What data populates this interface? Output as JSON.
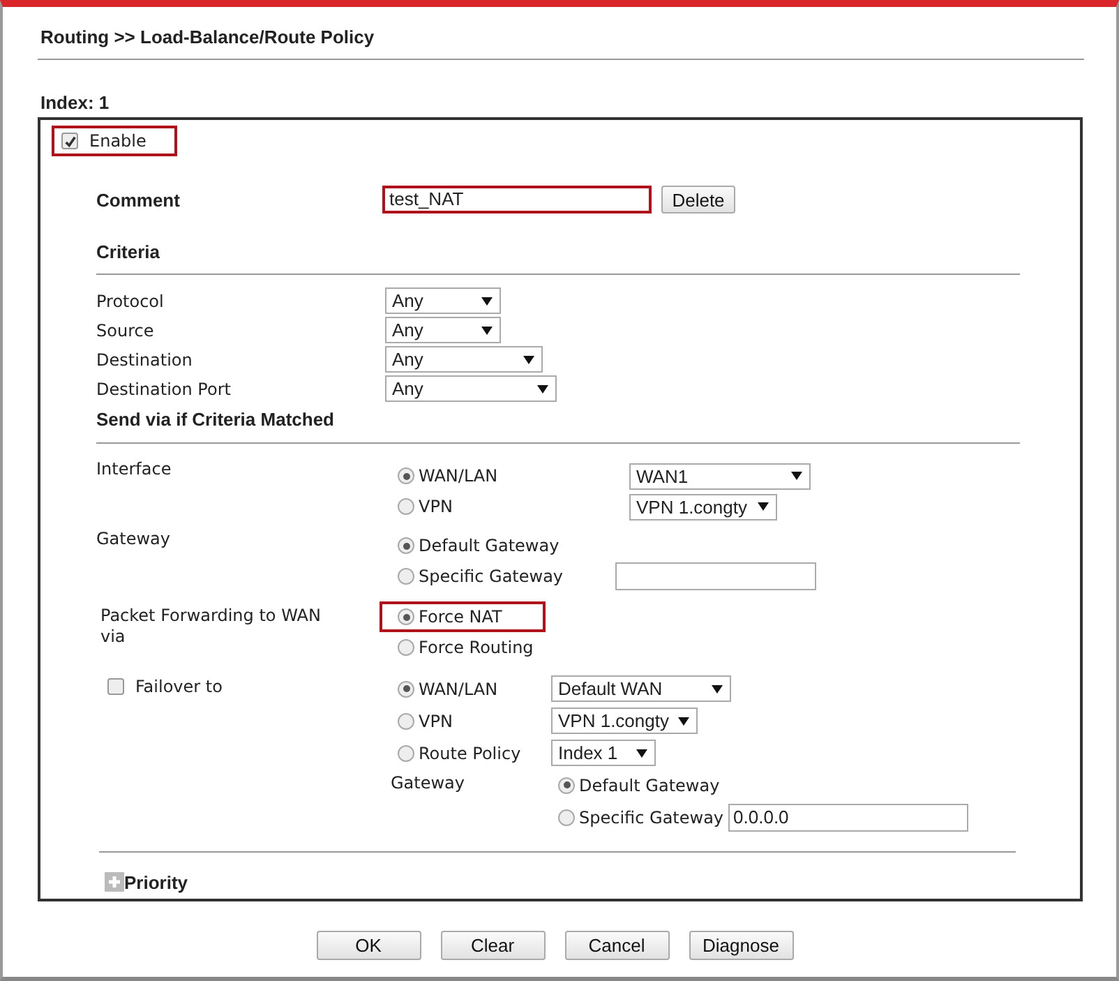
{
  "breadcrumb": "Routing >> Load-Balance/Route Policy",
  "index_label": "Index: 1",
  "enable": {
    "label": "Enable",
    "checked": true,
    "highlighted": true
  },
  "comment": {
    "label": "Comment",
    "value": "test_NAT",
    "highlighted": true,
    "button": "Delete"
  },
  "criteria": {
    "title": "Criteria",
    "fields": [
      {
        "label": "Protocol",
        "value": "Any"
      },
      {
        "label": "Source",
        "value": "Any"
      },
      {
        "label": "Destination",
        "value": "Any"
      },
      {
        "label": "Destination Port",
        "value": "Any"
      }
    ]
  },
  "send_via": {
    "title": "Send via if Criteria Matched",
    "interface": {
      "label": "Interface",
      "options": [
        {
          "label": "WAN/LAN",
          "selected": true,
          "kind": "select",
          "value": "WAN1"
        },
        {
          "label": "VPN",
          "selected": false,
          "kind": "select",
          "value": "VPN 1.congty"
        }
      ]
    },
    "gateway": {
      "label": "Gateway",
      "options": [
        {
          "label": "Default Gateway",
          "selected": true,
          "kind": "plain"
        },
        {
          "label": "Specific Gateway",
          "selected": false,
          "kind": "input"
        }
      ]
    },
    "packet_forwarding": {
      "label": "Packet Forwarding to WAN via",
      "options": [
        {
          "label": "Force NAT",
          "selected": true,
          "highlighted": true
        },
        {
          "label": "Force Routing",
          "selected": false,
          "highlighted": false
        }
      ]
    },
    "failover": {
      "label": "Failover to",
      "checked": false,
      "options": [
        {
          "label": "WAN/LAN",
          "selected": true,
          "kind": "select",
          "value": "Default WAN"
        },
        {
          "label": "VPN",
          "selected": false,
          "kind": "select",
          "value": "VPN 1.congty"
        },
        {
          "label": "Route Policy",
          "selected": false,
          "kind": "select",
          "value": "Index 1"
        }
      ],
      "gateway": {
        "label": "Gateway",
        "options": [
          {
            "label": "Default Gateway",
            "selected": true,
            "kind": "plain"
          },
          {
            "label": "Specific Gateway",
            "selected": false,
            "kind": "input",
            "value": "0.0.0.0"
          }
        ]
      }
    }
  },
  "priority": {
    "label": "Priority",
    "expanded": false
  },
  "buttons": [
    "OK",
    "Clear",
    "Cancel",
    "Diagnose"
  ]
}
